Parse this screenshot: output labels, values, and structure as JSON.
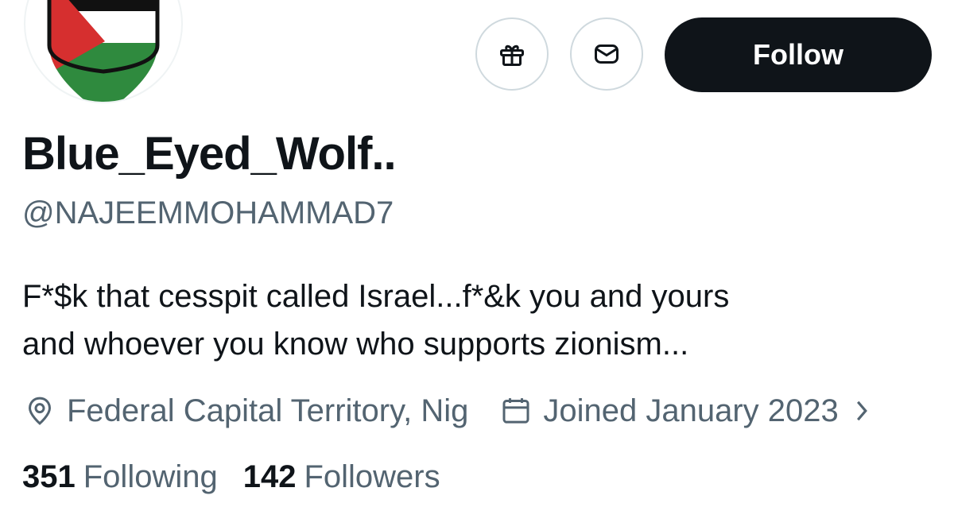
{
  "profile": {
    "display_name": "Blue_Eyed_Wolf..",
    "handle": "@NAJEEMMOHAMMAD7",
    "bio_lines": [
      "F*$k that cesspit called Israel...f*&k you and yours",
      "and whoever you know who supports zionism..."
    ],
    "location": "Federal Capital Territory, Nig",
    "joined": "Joined January 2023",
    "following_count": "351",
    "following_label": "Following",
    "followers_count": "142",
    "followers_label": "Followers"
  },
  "actions": {
    "follow_label": "Follow",
    "gift_icon": "gift-icon",
    "message_icon": "envelope-icon"
  },
  "icons": {
    "location": "location-pin-icon",
    "calendar": "calendar-icon",
    "chevron": "chevron-right-icon",
    "avatar": "palestine-flag-shield"
  },
  "colors": {
    "text_primary": "#0f1419",
    "text_secondary": "#536471",
    "button_dark": "#0f1419",
    "border": "#cfd9de",
    "flag_red": "#d62f2f",
    "flag_green": "#2f8a3e",
    "flag_black": "#111111"
  }
}
